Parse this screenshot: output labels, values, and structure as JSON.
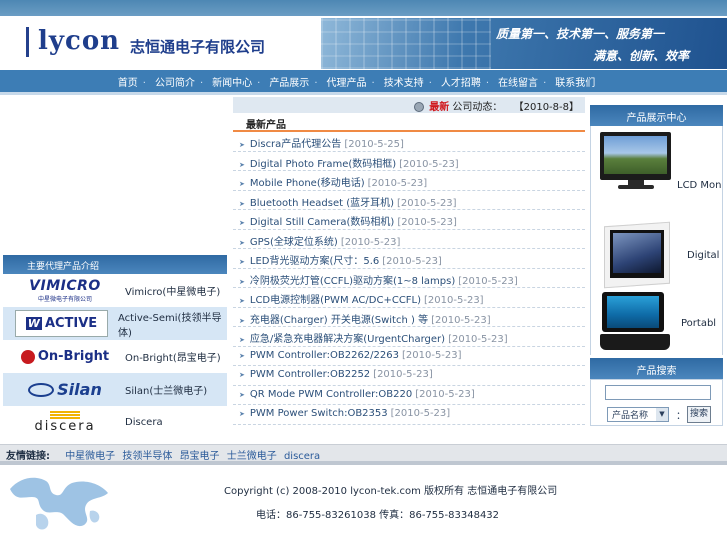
{
  "header": {
    "logo": "lycon",
    "company_name": "志恒通电子有限公司",
    "slogan_line1": "质量第一、技术第一、服务第一",
    "slogan_line2": "满意、创新、效率"
  },
  "nav": [
    "首页",
    "公司简介",
    "新闻中心",
    "产品展示",
    "代理产品",
    "技术支持",
    "人才招聘",
    "在线留言",
    "联系我们"
  ],
  "news": {
    "ticker_label": "最新",
    "ticker_text": "公司动态：",
    "ticker_date": "【2010-8-8】",
    "latest_title": "最新产品",
    "items": [
      {
        "title": "Discra产品代理公告",
        "date": "[2010-5-25]"
      },
      {
        "title": "Digital Photo Frame(数码相框)",
        "date": "[2010-5-23]"
      },
      {
        "title": "Mobile Phone(移动电话)",
        "date": "[2010-5-23]"
      },
      {
        "title": "Bluetooth Headset (蓝牙耳机)",
        "date": "[2010-5-23]"
      },
      {
        "title": "Digital Still Camera(数码相机)",
        "date": "[2010-5-23]"
      },
      {
        "title": "GPS(全球定位系统)",
        "date": "[2010-5-23]"
      },
      {
        "title": "LED背光驱动方案(尺寸：5.6",
        "date": "[2010-5-23]"
      },
      {
        "title": "冷阴极荧光灯管(CCFL)驱动方案(1~8 lamps)",
        "date": "[2010-5-23]"
      },
      {
        "title": "LCD电源控制器(PWM AC/DC+CCFL)",
        "date": "[2010-5-23]"
      },
      {
        "title": "充电器(Charger) 开关电源(Switch ) 等",
        "date": "[2010-5-23]"
      },
      {
        "title": "应急/紧急充电器解决方案(UrgentCharger)",
        "date": "[2010-5-23]"
      },
      {
        "title": "PWM Controller:OB2262/2263",
        "date": "[2010-5-23]"
      },
      {
        "title": "PWM Controller:OB2252",
        "date": "[2010-5-23]"
      },
      {
        "title": "QR Mode PWM Controller:OB220",
        "date": "[2010-5-23]"
      },
      {
        "title": "PWM Power Switch:OB2353",
        "date": "[2010-5-23]"
      }
    ]
  },
  "agents": {
    "title": "主要代理产品介绍",
    "items": [
      {
        "logo": "VIMICRO",
        "logo_sub": "中星微电子有限公司",
        "label": "Vimicro(中星微电子)"
      },
      {
        "logo": "ACTIVE",
        "logo_sub": "",
        "label": "Active-Semi(技领半导体)"
      },
      {
        "logo": "On-Bright",
        "logo_sub": "",
        "label": "On-Bright(昂宝电子)"
      },
      {
        "logo": "Silan",
        "logo_sub": "",
        "label": "Silan(士兰微电子)"
      },
      {
        "logo": "discera",
        "logo_sub": "",
        "label": "Discera"
      }
    ]
  },
  "products": {
    "title": "产品展示中心",
    "items": [
      {
        "label": "LCD Mon"
      },
      {
        "label": "Digital"
      },
      {
        "label": "Portabl"
      }
    ]
  },
  "search": {
    "title": "产品搜索",
    "input_value": "",
    "select_value": "产品名称",
    "sep": "：",
    "button": "搜索"
  },
  "links": {
    "label": "友情链接:",
    "items": [
      "中星微电子",
      "技领半导体",
      "昂宝电子",
      "士兰微电子",
      "discera"
    ]
  },
  "footer": {
    "copyright": "Copyright (c) 2008-2010 lycon-tek.com 版权所有 志恒通电子有限公司",
    "phones": "电话：86-755-83261038 传真：86-755-83348432"
  },
  "colors": {
    "accent": "#3d7db5",
    "brand": "#1f3e8c",
    "highlight": "#f08a44"
  }
}
